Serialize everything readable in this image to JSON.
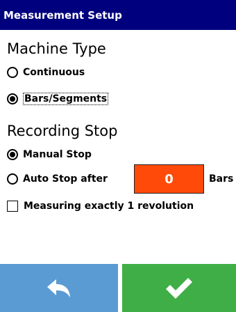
{
  "window": {
    "title": "Measurement Setup"
  },
  "machine_type": {
    "heading": "Machine Type",
    "options": [
      {
        "label": "Continuous",
        "selected": false
      },
      {
        "label": "Bars/Segments",
        "selected": true
      }
    ]
  },
  "recording_stop": {
    "heading": "Recording Stop",
    "manual_label": "Manual Stop",
    "manual_selected": true,
    "auto_label": "Auto Stop after",
    "auto_selected": false,
    "auto_value": "0",
    "auto_unit": "Bars",
    "exact_rev_label": "Measuring exactly 1 revolution",
    "exact_rev_checked": false
  },
  "buttons": {
    "back_icon": "back-arrow-icon",
    "confirm_icon": "checkmark-icon"
  },
  "colors": {
    "title_bar": "#00007f",
    "value_box": "#ff4a0a",
    "back_button": "#5a9bd3",
    "confirm_button": "#3fae46"
  }
}
